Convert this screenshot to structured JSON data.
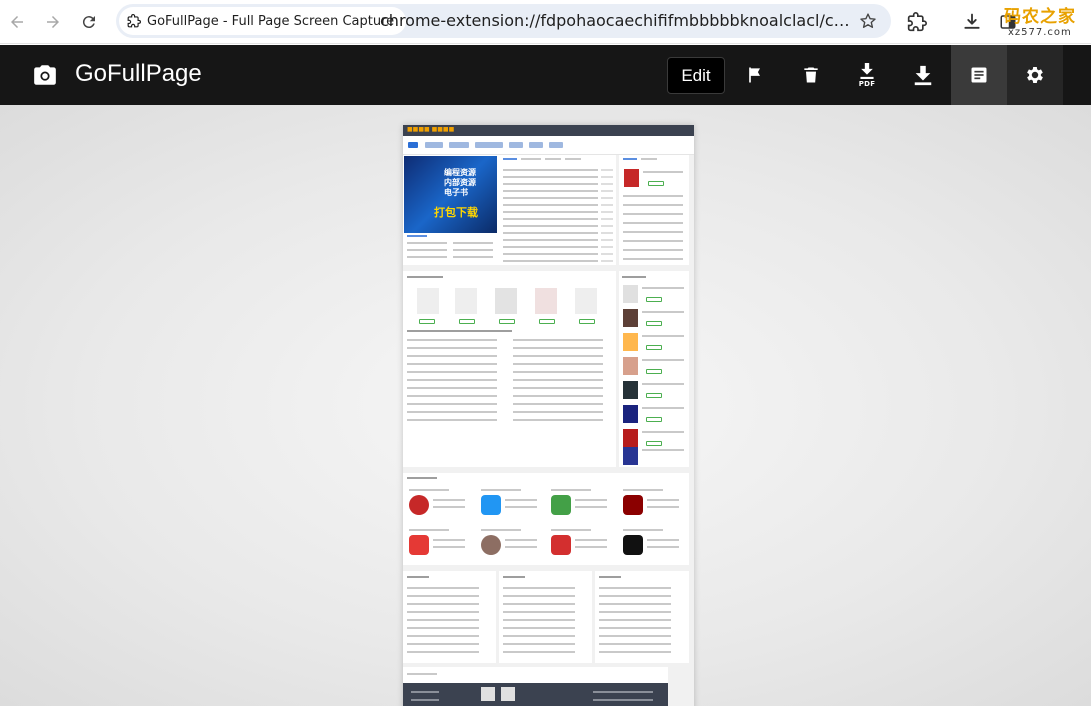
{
  "browser": {
    "extension_chip_label": "GoFullPage - Full Page Screen Capture",
    "url": "chrome-extension://fdpohaocaechififmbbbbbknoalclacl/capture.htm...",
    "watermark": {
      "top": "码农之家",
      "bottom": "xz577.com"
    }
  },
  "toolbar": {
    "app_title": "GoFullPage",
    "edit_label": "Edit",
    "pdf_label": "PDF",
    "icons": [
      "camera-icon",
      "flag-icon",
      "trash-icon",
      "pdf-download-icon",
      "download-icon",
      "document-icon",
      "gear-icon"
    ],
    "active_tab": "document-icon"
  },
  "screenshot_preview": {
    "banner_line1": "编程资源",
    "banner_line2": "内部资源",
    "banner_line3": "电子书",
    "banner_cta": "打包下载",
    "colors": {
      "header": "#3b4250",
      "accent_blue": "#2b6fd6",
      "banner_yellow": "#ffd600"
    }
  }
}
